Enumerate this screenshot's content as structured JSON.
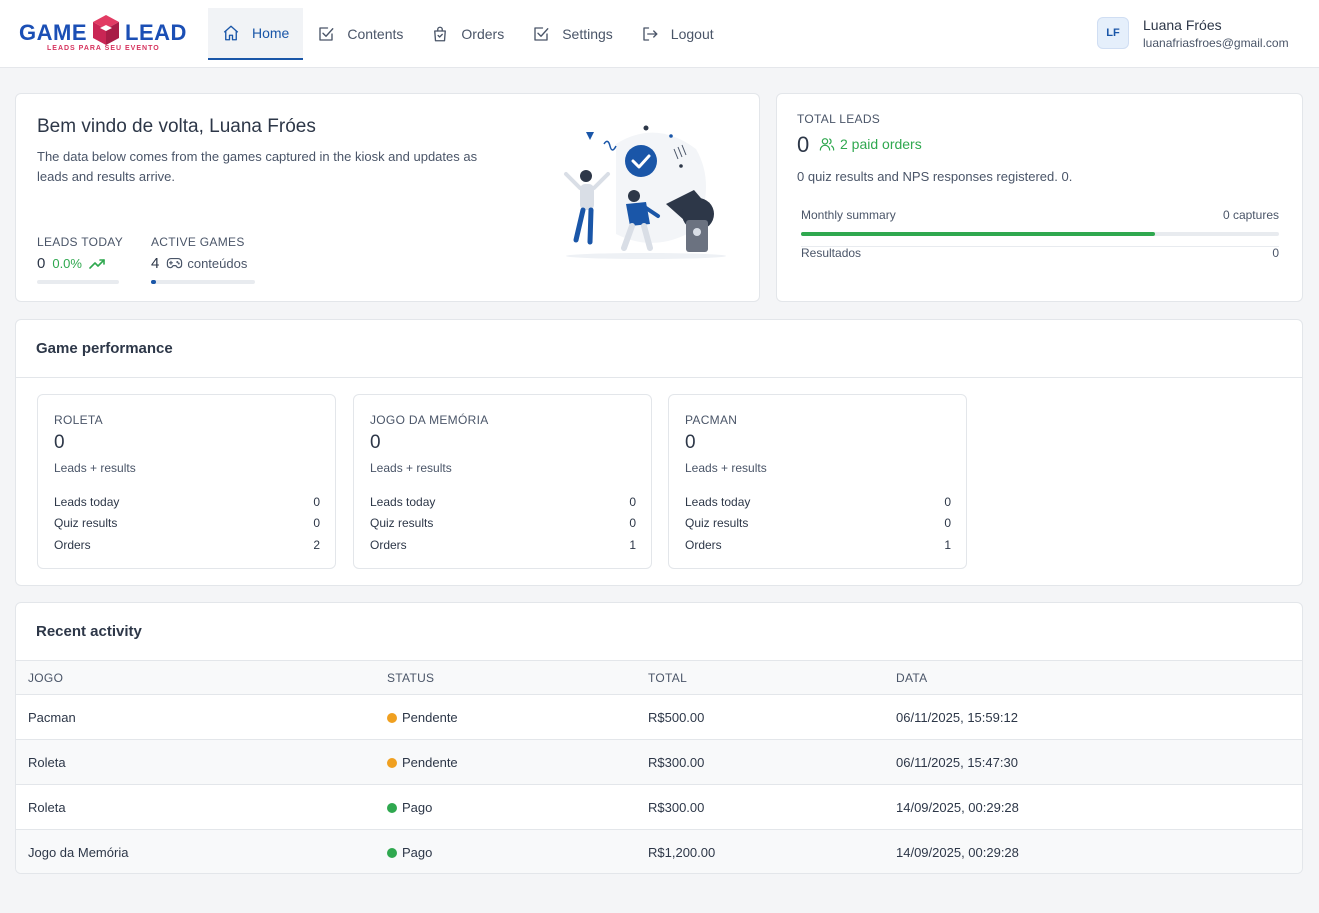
{
  "brand": {
    "left": "GAME",
    "right": "LEAD",
    "tagline": "LEADS PARA SEU EVENTO"
  },
  "nav": {
    "items": [
      {
        "label": "Home",
        "icon": "home-icon",
        "active": true
      },
      {
        "label": "Contents",
        "icon": "checkbox-icon"
      },
      {
        "label": "Orders",
        "icon": "shopping-bag-icon"
      },
      {
        "label": "Settings",
        "icon": "checkbox-icon"
      },
      {
        "label": "Logout",
        "icon": "logout-icon"
      }
    ]
  },
  "user": {
    "initials": "LF",
    "name": "Luana Fróes",
    "email": "luanafriasfroes@gmail.com"
  },
  "welcome": {
    "title": "Bem vindo de volta, Luana Fróes",
    "description": "The data below comes from the games captured in the kiosk and updates as leads and results arrive.",
    "leads_today": {
      "label": "LEADS TODAY",
      "value": "0",
      "change": "0.0%"
    },
    "active_games": {
      "label": "ACTIVE GAMES",
      "value": "4",
      "unit": "conteúdos",
      "progress": 0.05
    }
  },
  "total_leads": {
    "label": "TOTAL LEADS",
    "value": "0",
    "paid_orders": "2 paid orders",
    "description": "0 quiz results and NPS responses registered. 0.",
    "monthly_label": "Monthly summary",
    "monthly_value": "0 captures",
    "monthly_progress": 0.74,
    "results_label": "Resultados",
    "results_value": "0"
  },
  "performance": {
    "title": "Game performance",
    "games": [
      {
        "name": "ROLETA",
        "total": "0",
        "subtitle": "Leads + results",
        "leads_label": "Leads today",
        "leads": "0",
        "quiz_label": "Quiz results",
        "quiz": "0",
        "orders_label": "Orders",
        "orders": "2"
      },
      {
        "name": "JOGO DA MEMÓRIA",
        "total": "0",
        "subtitle": "Leads + results",
        "leads_label": "Leads today",
        "leads": "0",
        "quiz_label": "Quiz results",
        "quiz": "0",
        "orders_label": "Orders",
        "orders": "1"
      },
      {
        "name": "PACMAN",
        "total": "0",
        "subtitle": "Leads + results",
        "leads_label": "Leads today",
        "leads": "0",
        "quiz_label": "Quiz results",
        "quiz": "0",
        "orders_label": "Orders",
        "orders": "1"
      }
    ]
  },
  "recent": {
    "title": "Recent activity",
    "columns": [
      "JOGO",
      "STATUS",
      "TOTAL",
      "DATA"
    ],
    "rows": [
      {
        "jogo": "Pacman",
        "status": "Pendente",
        "status_color": "#f0a020",
        "total": "R$500.00",
        "data": "06/11/2025, 15:59:12"
      },
      {
        "jogo": "Roleta",
        "status": "Pendente",
        "status_color": "#f0a020",
        "total": "R$300.00",
        "data": "06/11/2025, 15:47:30"
      },
      {
        "jogo": "Roleta",
        "status": "Pago",
        "status_color": "#2fa84f",
        "total": "R$300.00",
        "data": "14/09/2025, 00:29:28"
      },
      {
        "jogo": "Jogo da Memória",
        "status": "Pago",
        "status_color": "#2fa84f",
        "total": "R$1,200.00",
        "data": "14/09/2025, 00:29:28"
      }
    ]
  },
  "colors": {
    "primary": "#1a56a8",
    "success": "#2fa84f",
    "warning": "#f0a020",
    "brand_red": "#d6335e"
  }
}
